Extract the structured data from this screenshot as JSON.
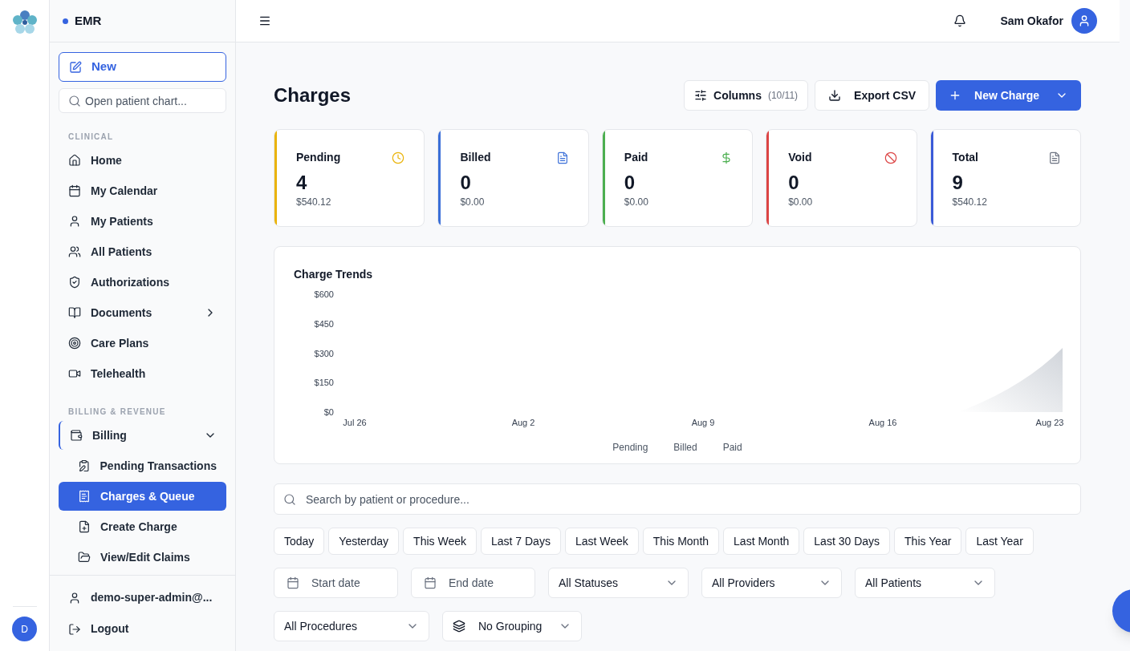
{
  "rail": {
    "avatar": "D"
  },
  "sidebar": {
    "brand": "EMR",
    "new_button": "New",
    "search": {
      "placeholder": "Open patient chart..."
    },
    "sections": [
      {
        "title": "CLINICAL",
        "items": [
          {
            "label": "Home",
            "selected": false,
            "has_submenu": false
          },
          {
            "label": "My Calendar",
            "selected": false,
            "has_submenu": false
          },
          {
            "label": "My Patients",
            "selected": false,
            "has_submenu": false
          },
          {
            "label": "All Patients",
            "selected": false,
            "has_submenu": false
          },
          {
            "label": "Authorizations",
            "selected": false,
            "has_submenu": false
          },
          {
            "label": "Documents",
            "selected": false,
            "has_submenu": true
          },
          {
            "label": "Care Plans",
            "selected": false,
            "has_submenu": false
          },
          {
            "label": "Telehealth",
            "selected": false,
            "has_submenu": false
          }
        ]
      },
      {
        "title": "BILLING & REVENUE",
        "items": [
          {
            "label": "Billing",
            "selected": false,
            "expanded": true,
            "children": [
              {
                "label": "Pending Transactions",
                "selected": false
              },
              {
                "label": "Charges & Queue",
                "selected": true
              },
              {
                "label": "Create Charge",
                "selected": false
              },
              {
                "label": "View/Edit Claims",
                "selected": false
              }
            ]
          }
        ]
      }
    ],
    "footer": [
      "demo-super-admin@...",
      "Logout"
    ]
  },
  "header": {
    "user": "Sam Okafor"
  },
  "page": {
    "title": "Charges",
    "columns_button": {
      "label": "Columns",
      "count": "(10/11)"
    },
    "export_button": "Export CSV",
    "new_button": "New Charge"
  },
  "stats": [
    {
      "label": "Pending",
      "value": "4",
      "amount": "$540.12",
      "color": "#eab308"
    },
    {
      "label": "Billed",
      "value": "0",
      "amount": "$0.00",
      "color": "#3b6fd8"
    },
    {
      "label": "Paid",
      "value": "0",
      "amount": "$0.00",
      "color": "#4caf50"
    },
    {
      "label": "Void",
      "value": "0",
      "amount": "$0.00",
      "color": "#dc4444"
    },
    {
      "label": "Total",
      "value": "9",
      "amount": "$540.12",
      "color": "#3b5bd8"
    }
  ],
  "trend": {
    "title": "Charge Trends",
    "y_axis_labels": [
      "$600",
      "$450",
      "$300",
      "$150",
      "$0"
    ],
    "x_axis_labels": [
      "Jul 26",
      "Aug 2",
      "Aug 9",
      "Aug 16",
      "Aug 23"
    ],
    "legend": [
      "Pending",
      "Billed",
      "Paid"
    ]
  },
  "filters": {
    "search": {
      "placeholder": "Search by patient or procedure..."
    },
    "ranges": [
      {
        "label": "Today",
        "selected": false
      },
      {
        "label": "Yesterday",
        "selected": false
      },
      {
        "label": "This Week",
        "selected": false
      },
      {
        "label": "Last 7 Days",
        "selected": false
      },
      {
        "label": "Last Week",
        "selected": false
      },
      {
        "label": "This Month",
        "selected": false
      },
      {
        "label": "Last Month",
        "selected": false
      },
      {
        "label": "Last 30 Days",
        "selected": false
      },
      {
        "label": "This Year",
        "selected": false
      },
      {
        "label": "Last Year",
        "selected": false
      }
    ],
    "start_date": {
      "placeholder": "Start date"
    },
    "end_date": {
      "placeholder": "End date"
    },
    "selects": [
      "All Statuses",
      "All Providers",
      "All Patients",
      "All Procedures"
    ],
    "grouping": "No Grouping"
  }
}
